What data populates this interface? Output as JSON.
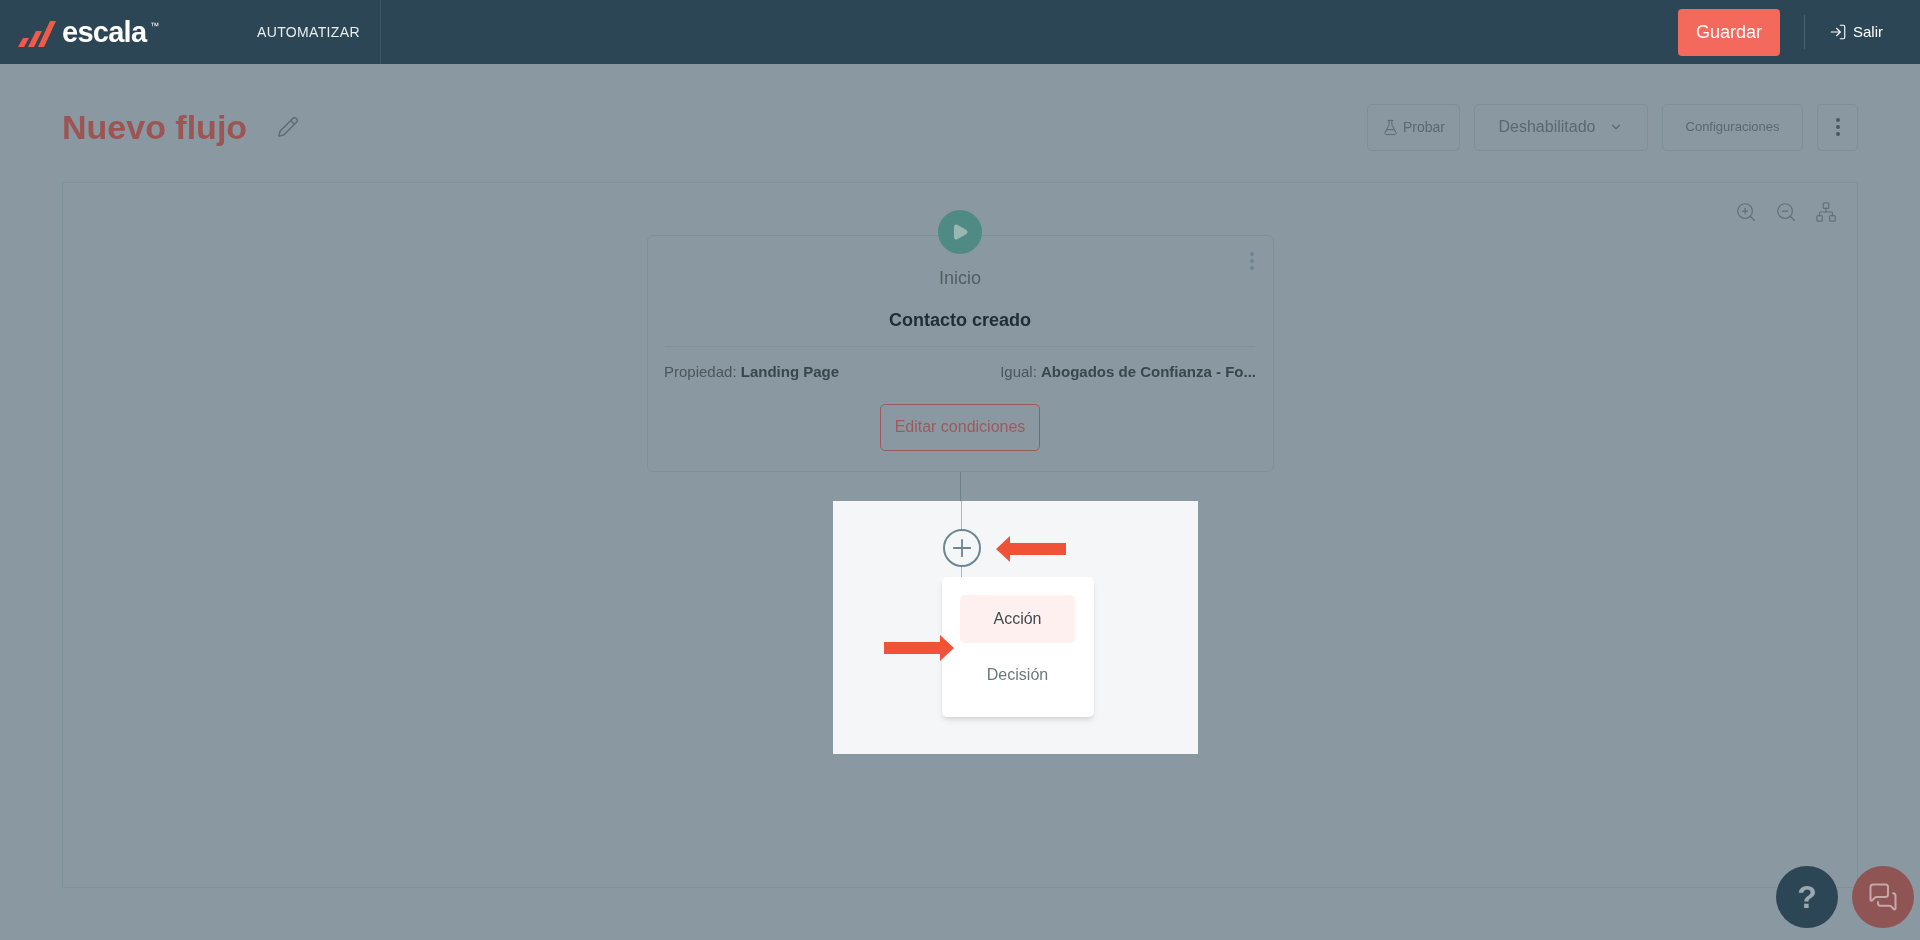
{
  "header": {
    "logo": {
      "word": "escala",
      "mark": "™"
    },
    "nav_item": {
      "label": "AUTOMATIZAR",
      "selected": false
    },
    "save_button": "Guardar",
    "exit_link": "Salir"
  },
  "title": "Nuevo flujo",
  "toolbar": {
    "test_button": "Probar",
    "status_dropdown": "Deshabilitado",
    "settings_button": "Configuraciones"
  },
  "flow": {
    "start_node": {
      "label": "Inicio",
      "trigger": "Contacto creado",
      "conditions": [
        {
          "name": "Propiedad:",
          "value": "Landing Page"
        },
        {
          "name": "Igual:",
          "value": "Abogados de Confianza - Fo..."
        }
      ],
      "edit_button": "Editar condiciones"
    },
    "add_menu": {
      "items": [
        {
          "label": "Acción",
          "selected": true
        },
        {
          "label": "Decisión",
          "selected": false
        }
      ]
    }
  },
  "help_button": "?"
}
